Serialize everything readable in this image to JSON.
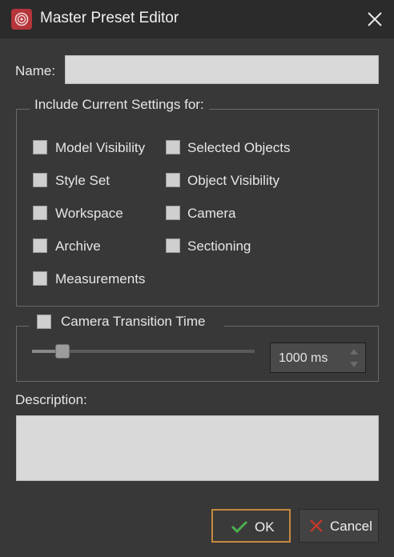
{
  "window": {
    "title": "Master Preset Editor",
    "app_icon": "app-logo-icon",
    "close_icon": "close-icon"
  },
  "name_field": {
    "label": "Name:",
    "value": ""
  },
  "settings_group": {
    "title": "Include Current Settings for:",
    "options": [
      {
        "label": "Model Visibility",
        "checked": false
      },
      {
        "label": "Style Set",
        "checked": false
      },
      {
        "label": "Workspace",
        "checked": false
      },
      {
        "label": "Archive",
        "checked": false
      },
      {
        "label": "Measurements",
        "checked": false
      },
      {
        "label": "Selected Objects",
        "checked": false
      },
      {
        "label": "Object Visibility",
        "checked": false
      },
      {
        "label": "Camera",
        "checked": false
      },
      {
        "label": "Sectioning",
        "checked": false
      }
    ]
  },
  "camera_transition": {
    "label": "Camera Transition Time",
    "checked": false,
    "slider_level": 0.11,
    "value": "1000 ms"
  },
  "description": {
    "label": "Description:",
    "value": ""
  },
  "buttons": {
    "ok": {
      "label": "OK",
      "icon": "checkmark-icon"
    },
    "cancel": {
      "label": "Cancel",
      "icon": "x-icon"
    }
  },
  "colors": {
    "background": "#383838",
    "titlebar": "#2b2b2b",
    "accent_ok_border": "#c58a3e",
    "ok_check": "#4caf50",
    "cancel_x": "#c0392b",
    "app_icon": "#b5353a"
  }
}
